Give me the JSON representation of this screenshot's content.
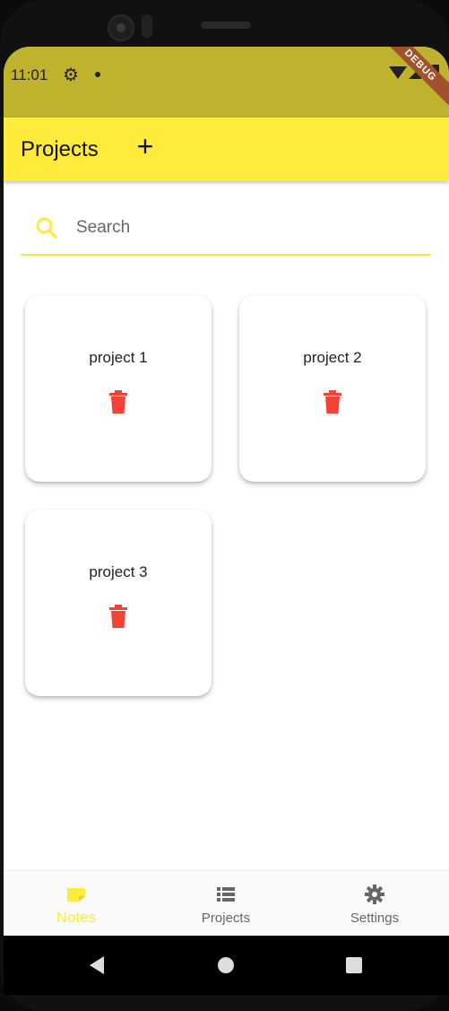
{
  "status_bar": {
    "time": "11:01",
    "debug_label": "DEBUG"
  },
  "app_bar": {
    "title": "Projects",
    "add_label": "+"
  },
  "search": {
    "placeholder": "Search",
    "value": ""
  },
  "projects": [
    {
      "name": "project 1"
    },
    {
      "name": "project 2"
    },
    {
      "name": "project 3"
    }
  ],
  "bottom_nav": {
    "items": [
      {
        "label": "Notes",
        "icon": "note-icon",
        "active": true
      },
      {
        "label": "Projects",
        "icon": "list-icon",
        "active": false
      },
      {
        "label": "Settings",
        "icon": "gear-icon",
        "active": false
      }
    ]
  },
  "colors": {
    "accent": "#ffeb3b",
    "status_bar": "#bfb22c",
    "delete": "#f44336",
    "inactive": "#666666"
  }
}
